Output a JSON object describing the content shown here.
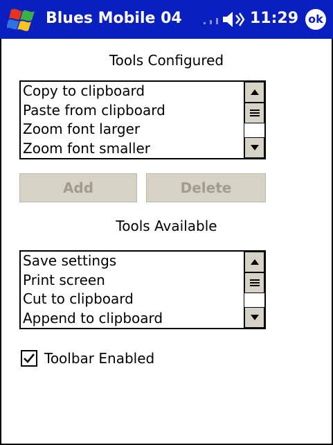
{
  "titlebar": {
    "title": "Blues Mobile 04",
    "time": "11:29",
    "ok_label": "ok",
    "start_icon": "windows-flag-icon",
    "volume_icon": "speaker-icon",
    "signal_icon": "signal-icon"
  },
  "configured": {
    "label": "Tools Configured",
    "items": [
      "Copy to clipboard",
      "Paste from clipboard",
      "Zoom font larger",
      "Zoom font smaller"
    ]
  },
  "buttons": {
    "add_label": "Add",
    "delete_label": "Delete",
    "enabled": false
  },
  "available": {
    "label": "Tools Available",
    "items": [
      "Save settings",
      "Print screen",
      "Cut to clipboard",
      "Append to clipboard"
    ]
  },
  "toolbar": {
    "enabled_label": "Toolbar Enabled",
    "checked": true
  },
  "colors": {
    "titlebar": "#0a1fbf",
    "button_face": "#d6d2c6",
    "disabled_text": "#a09c90"
  }
}
